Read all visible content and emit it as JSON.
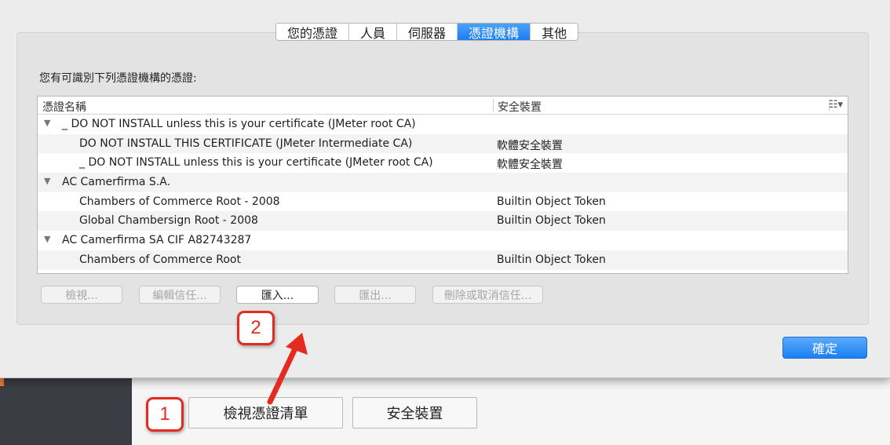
{
  "background_page": {
    "buttons": {
      "view_certs": "檢視憑證清單",
      "security_devices": "安全裝置"
    }
  },
  "dialog": {
    "tabs": [
      {
        "label": "您的憑證",
        "active": false
      },
      {
        "label": "人員",
        "active": false
      },
      {
        "label": "伺服器",
        "active": false
      },
      {
        "label": "憑證機構",
        "active": true
      },
      {
        "label": "其他",
        "active": false
      }
    ],
    "intro": "您有可識別下列憑證機構的憑證:",
    "table": {
      "columns": [
        "憑證名稱",
        "安全裝置"
      ],
      "rows": [
        {
          "name": "_ DO NOT INSTALL unless this is your certificate (JMeter root CA)",
          "device": "",
          "group": true
        },
        {
          "name": "DO NOT INSTALL THIS CERTIFICATE (JMeter Intermediate CA)",
          "device": "軟體安全裝置",
          "group": false
        },
        {
          "name": "_ DO NOT INSTALL unless this is your certificate (JMeter root CA)",
          "device": "軟體安全裝置",
          "group": false
        },
        {
          "name": "AC Camerfirma S.A.",
          "device": "",
          "group": true
        },
        {
          "name": "Chambers of Commerce Root - 2008",
          "device": "Builtin Object Token",
          "group": false
        },
        {
          "name": "Global Chambersign Root - 2008",
          "device": "Builtin Object Token",
          "group": false
        },
        {
          "name": "AC Camerfirma SA CIF A82743287",
          "device": "",
          "group": true
        },
        {
          "name": "Chambers of Commerce Root",
          "device": "Builtin Object Token",
          "group": false
        }
      ]
    },
    "buttons": {
      "view": "檢視...",
      "edit_trust": "編輯信任...",
      "import": "匯入...",
      "export": "匯出...",
      "delete": "刪除或取消信任..."
    },
    "ok": "確定"
  },
  "annotations": {
    "step1": "1",
    "step2": "2"
  },
  "colors": {
    "accent": "#1d7cf2",
    "annotation": "#e52b1f"
  }
}
